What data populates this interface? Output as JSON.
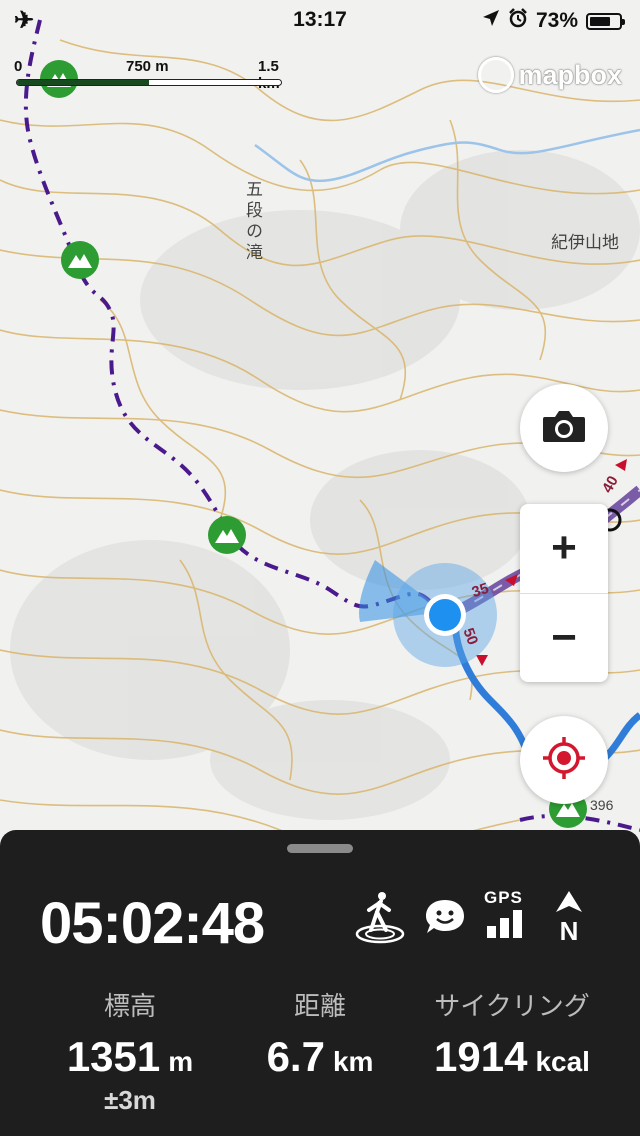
{
  "status": {
    "time": "13:17",
    "battery": "73%",
    "battery_level": 0.73
  },
  "scale": {
    "start": "0",
    "mid": "750 m",
    "end": "1.5 km"
  },
  "attribution": {
    "brand": "mapbox"
  },
  "map_labels": {
    "waterfall": "五段の滝",
    "area": "紀伊山地",
    "elevation_point": "396"
  },
  "road_labels": {
    "speed_a": "35",
    "speed_b": "50",
    "speed_c": "40"
  },
  "icons": {
    "camera": "camera-icon",
    "zoom_in": "+",
    "zoom_out": "−",
    "locate": "crosshair-icon",
    "activity": "hiker-icon",
    "mood": "smiley-icon",
    "gps": "GPS",
    "north": "N"
  },
  "panel": {
    "elapsed_time": "05:02:48",
    "stats": [
      {
        "label": "標高",
        "value": "1351",
        "unit": "m",
        "accuracy": "±3m"
      },
      {
        "label": "距離",
        "value": "6.7",
        "unit": "km"
      },
      {
        "label": "サイクリング",
        "value": "1914",
        "unit": "kcal"
      }
    ]
  },
  "colors": {
    "peak_green": "#2d9c33",
    "trail_purple": "#4a1a8c",
    "route_blue": "#2f7dd8",
    "location_blue": "#1e90f0",
    "panel_bg": "#1e1e1f"
  }
}
